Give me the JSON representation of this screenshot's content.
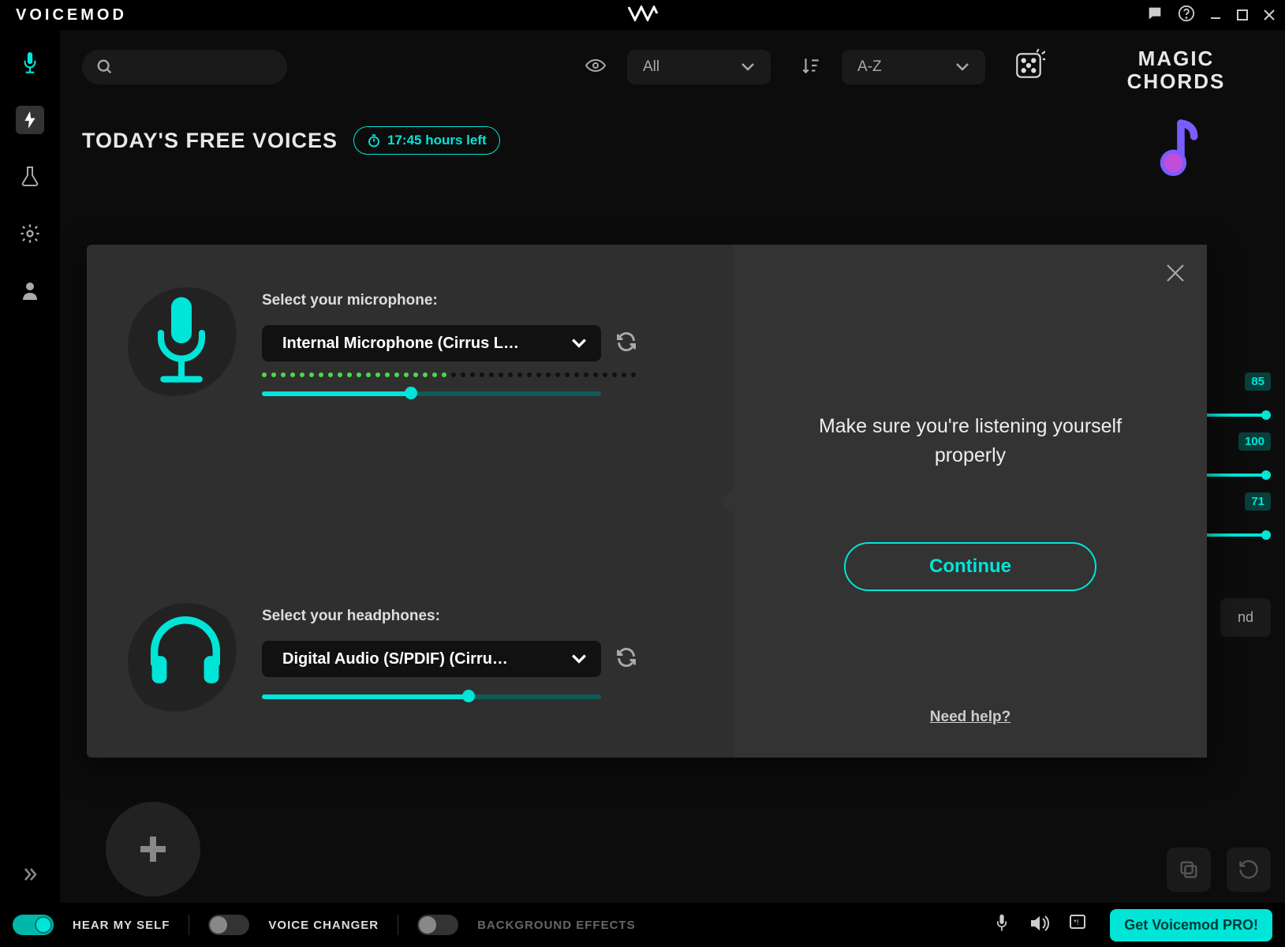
{
  "titlebar": {
    "brand": "VOICEMOD"
  },
  "filters": {
    "view_all": "All",
    "sort": "A-Z"
  },
  "section": {
    "title": "TODAY'S FREE VOICES",
    "timer": "17:45 hours left"
  },
  "rightpanel": {
    "title_l1": "MAGIC",
    "title_l2": "CHORDS",
    "s1": "85",
    "s2": "100",
    "s3": "71",
    "button": "nd"
  },
  "bottombar": {
    "hear": "HEAR MY SELF",
    "changer": "VOICE CHANGER",
    "bg": "BACKGROUND EFFECTS",
    "pro": "Get Voicemod PRO!"
  },
  "modal": {
    "mic_label": "Select your microphone:",
    "mic_value": "Internal Microphone (Cirrus L…",
    "hp_label": "Select your headphones:",
    "hp_value": "Digital Audio (S/PDIF) (Cirru…",
    "mic_slider_pct": 44,
    "mic_level_pct": 50,
    "hp_slider_pct": 61,
    "message": "Make sure you're listening yourself properly",
    "continue": "Continue",
    "help": "Need help?"
  }
}
